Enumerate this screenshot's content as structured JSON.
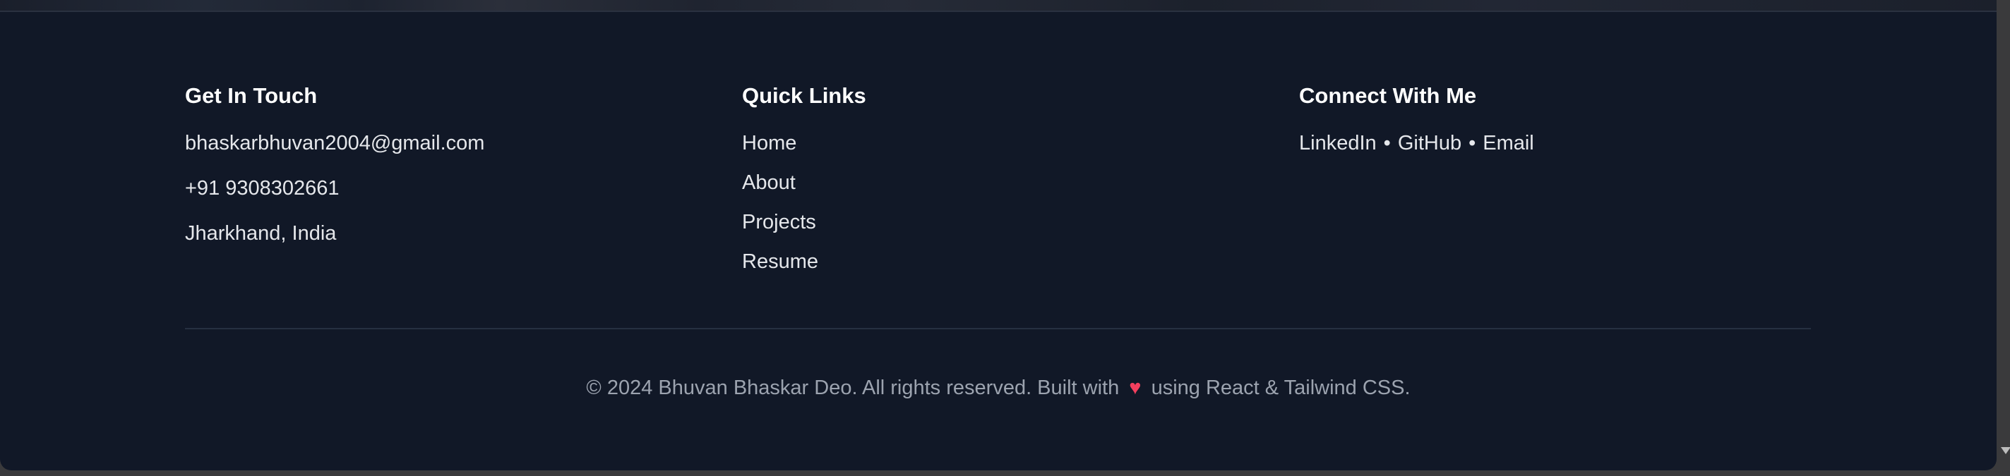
{
  "contact": {
    "heading": "Get In Touch",
    "email": "bhaskarbhuvan2004@gmail.com",
    "phone": "+91 9308302661",
    "location": "Jharkhand, India"
  },
  "quick_links": {
    "heading": "Quick Links",
    "items": [
      "Home",
      "About",
      "Projects",
      "Resume"
    ]
  },
  "connect": {
    "heading": "Connect With Me",
    "links": [
      "LinkedIn",
      "GitHub",
      "Email"
    ],
    "separator": "•"
  },
  "copyright": {
    "before": "© 2024 Bhuvan Bhaskar Deo. All rights reserved. Built with",
    "heart": "♥",
    "after": "using React & Tailwind CSS."
  },
  "colors": {
    "background": "#111827",
    "heading": "#ffffff",
    "text": "#e5e7eb",
    "muted": "#9ca3af",
    "heart": "#f43f5e"
  },
  "icons": {
    "heart": "heart-icon"
  }
}
